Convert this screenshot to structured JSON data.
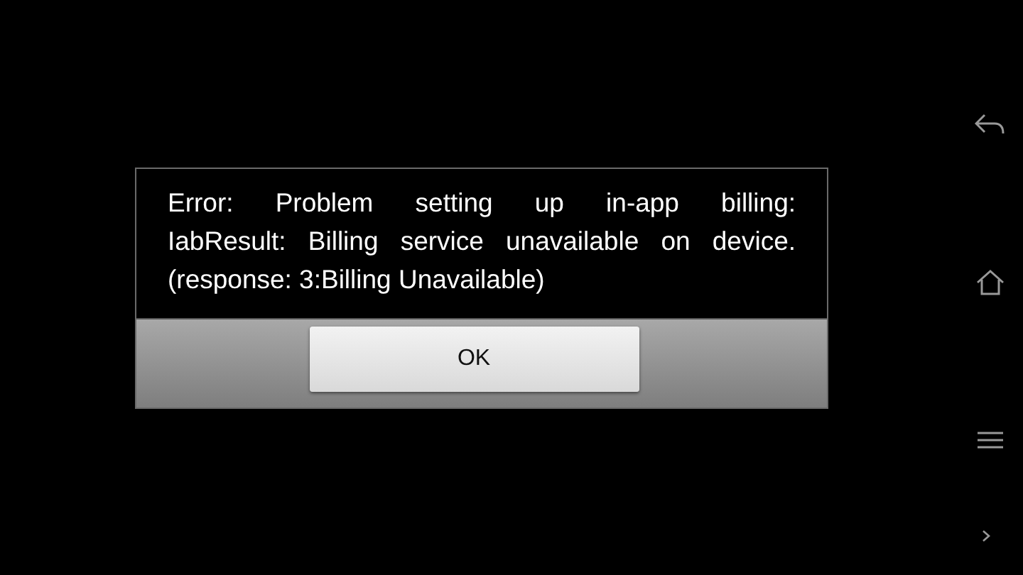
{
  "dialog": {
    "message_lines": [
      "Error: Problem setting up in-app billing:",
      "IabResult: Billing service unavailable on device.",
      "(response: 3:Billing Unavailable)"
    ],
    "buttons": [
      "OK"
    ]
  }
}
